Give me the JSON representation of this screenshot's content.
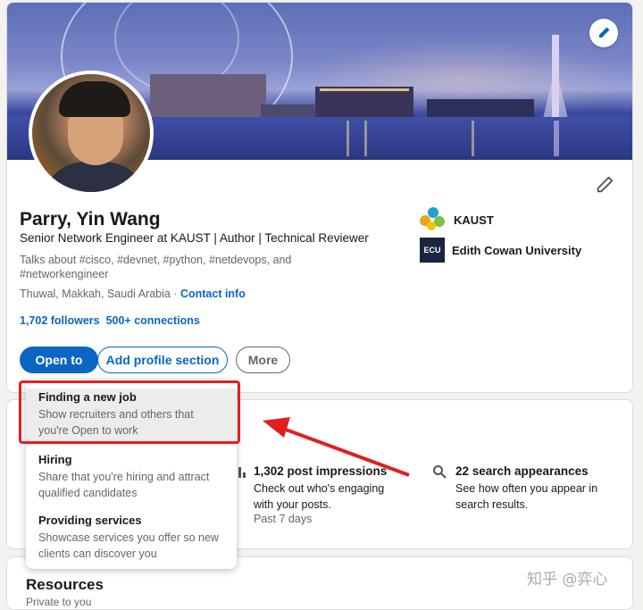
{
  "profile": {
    "name": "Parry, Yin Wang",
    "headline": "Senior Network Engineer at KAUST | Author | Technical Reviewer",
    "talks_about": "Talks about #cisco, #devnet, #python, #netdevops, and #networkengineer",
    "location": "Thuwal, Makkah, Saudi Arabia",
    "location_sep": " · ",
    "contact_info": "Contact info",
    "followers": "1,702 followers",
    "connections": "500+ connections",
    "organizations": [
      {
        "name": "KAUST",
        "icon": "kaust-logo"
      },
      {
        "name": "Edith Cowan University",
        "icon": "ecu-logo",
        "logo_text": "ECU"
      }
    ]
  },
  "actions": {
    "open_to": "Open to",
    "add_profile_section": "Add profile section",
    "more": "More"
  },
  "dropdown": {
    "items": [
      {
        "title": "Finding a new job",
        "desc": "Show recruiters and others that you're Open to work"
      },
      {
        "title": "Hiring",
        "desc": "Share that you're hiring and attract qualified candidates"
      },
      {
        "title": "Providing services",
        "desc": "Showcase services you offer so new clients can discover you"
      }
    ]
  },
  "analytics": {
    "impressions": {
      "title": "1,302 post impressions",
      "desc": "Check out who's engaging with your posts.",
      "sub": "Past 7 days"
    },
    "search": {
      "title": "22 search appearances",
      "desc": "See how often you appear in search results."
    }
  },
  "resources": {
    "title": "Resources",
    "subtitle": "Private to you"
  },
  "watermark": "知乎 @弈心",
  "colors": {
    "brand_blue": "#0a66c2",
    "highlight_red": "#e02020"
  }
}
